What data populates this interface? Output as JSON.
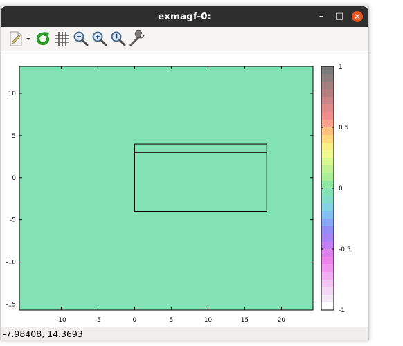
{
  "window": {
    "title": "exmagf-0:"
  },
  "window_controls": {
    "minimize": "–",
    "maximize": "□",
    "close": "✕"
  },
  "toolbar": {
    "items": [
      {
        "name": "export-document-icon"
      },
      {
        "name": "replot-icon"
      },
      {
        "name": "grid-icon"
      },
      {
        "name": "zoom-out-icon"
      },
      {
        "name": "zoom-in-icon"
      },
      {
        "name": "zoom-reset-icon"
      },
      {
        "name": "settings-wrench-icon"
      }
    ]
  },
  "status": {
    "coords": "-7.98408,  14.3693"
  },
  "chart_data": {
    "type": "heatmap",
    "title": "",
    "xlabel": "",
    "ylabel": "",
    "xlim": [
      -15.7,
      24.3
    ],
    "ylim": [
      -15.7,
      13.2
    ],
    "xticks": [
      "-10",
      "-5",
      "0",
      "5",
      "10",
      "15",
      "20"
    ],
    "xtick_values": [
      -10,
      -5,
      0,
      5,
      10,
      15,
      20
    ],
    "yticks": [
      "10",
      "5",
      "0",
      "-5",
      "-10",
      "-15"
    ],
    "ytick_values": [
      10,
      5,
      0,
      -5,
      -10,
      -15
    ],
    "field_value": 0,
    "fill_color": "#82e2b4",
    "outlines": [
      {
        "x0": 0,
        "x1": 18,
        "y0": -4,
        "y1": 4
      },
      {
        "x0": 0,
        "x1": 18,
        "y0": 3,
        "y1": 3
      }
    ],
    "colorbar": {
      "min": -1,
      "max": 1,
      "ticks": [
        "1",
        "0.5",
        "0",
        "-0.5",
        "-1"
      ],
      "tick_values": [
        1,
        0.5,
        0,
        -0.5,
        -1
      ],
      "colors_top_to_bottom": [
        "#7a7a7a",
        "#8e7f7f",
        "#a37f80",
        "#b57f80",
        "#c98587",
        "#e08a8a",
        "#f28d8d",
        "#f8a08a",
        "#fbc07e",
        "#fbd97c",
        "#f8ef86",
        "#f0f88e",
        "#d9f890",
        "#c0f294",
        "#a8ee96",
        "#8ee8a0",
        "#82e2b4",
        "#82dccc",
        "#82d2e2",
        "#82c0f2",
        "#8aa8f8",
        "#968ef8",
        "#a884f4",
        "#c480f2",
        "#dc80ee",
        "#ec82ea",
        "#f096ee",
        "#f2aef2",
        "#f2c4f4",
        "#f2d8f4",
        "#f4e8f6",
        "#ffffff"
      ]
    }
  }
}
